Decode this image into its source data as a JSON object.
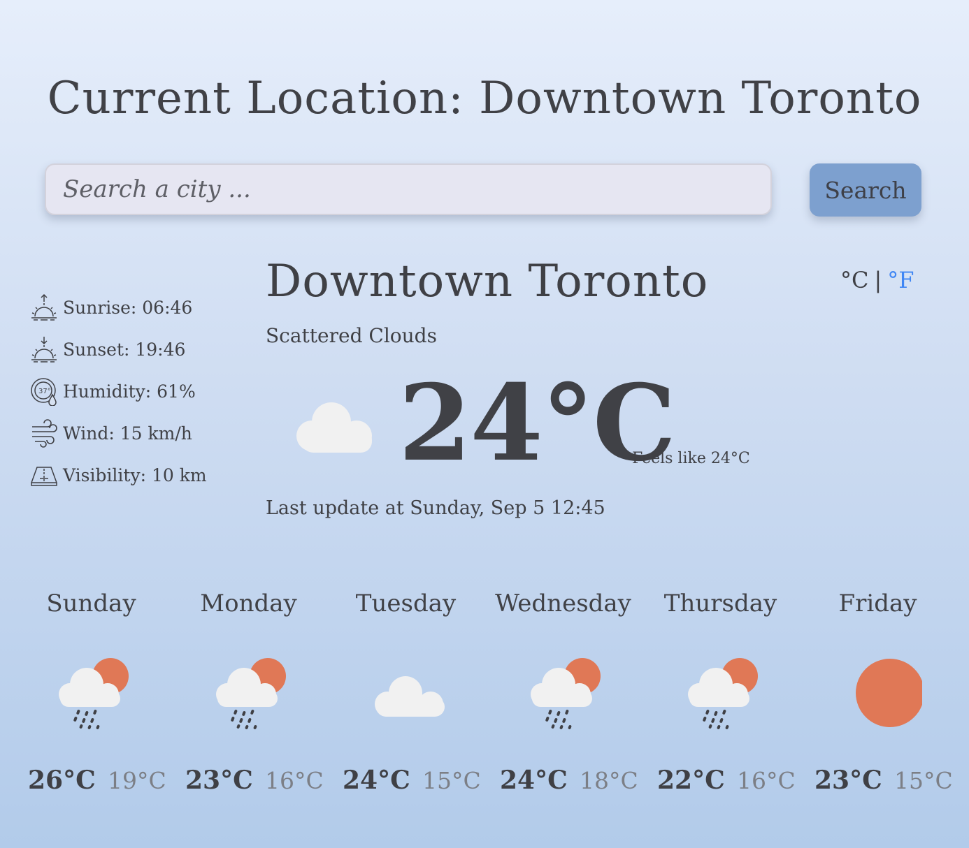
{
  "header": {
    "title": "Current Location: Downtown Toronto"
  },
  "search": {
    "placeholder": "Search a city ...",
    "button_label": "Search"
  },
  "stats": [
    {
      "icon": "sunrise-icon",
      "label": "Sunrise: 06:46"
    },
    {
      "icon": "sunset-icon",
      "label": "Sunset: 19:46"
    },
    {
      "icon": "humidity-icon",
      "label": "Humidity: 61%"
    },
    {
      "icon": "wind-icon",
      "label": "Wind: 15 km/h"
    },
    {
      "icon": "visibility-icon",
      "label": "Visibility: 10 km"
    }
  ],
  "current": {
    "city": "Downtown Toronto",
    "description": "Scattered Clouds",
    "icon": "cloud-icon",
    "temperature": "24°C",
    "feels_like": "Feels like 24°C",
    "last_update": "Last update at Sunday, Sep 5 12:45",
    "unit_c": "°C",
    "unit_separator": "|",
    "unit_f": "°F"
  },
  "forecast": [
    {
      "day": "Sunday",
      "icon": "sun-cloud-rain-icon",
      "high": "26°C",
      "low": "19°C"
    },
    {
      "day": "Monday",
      "icon": "sun-cloud-rain-icon",
      "high": "23°C",
      "low": "16°C"
    },
    {
      "day": "Tuesday",
      "icon": "cloud-icon",
      "high": "24°C",
      "low": "15°C"
    },
    {
      "day": "Wednesday",
      "icon": "sun-cloud-rain-icon",
      "high": "24°C",
      "low": "18°C"
    },
    {
      "day": "Thursday",
      "icon": "sun-cloud-rain-icon",
      "high": "22°C",
      "low": "16°C"
    },
    {
      "day": "Friday",
      "icon": "sun-icon",
      "high": "23°C",
      "low": "15°C"
    }
  ],
  "colors": {
    "accent": "#3f86f4",
    "button": "#7da0cf",
    "sun": "#e07856",
    "cloud": "#f2f2f2",
    "text": "#3f4045",
    "muted": "#7c7f86"
  }
}
